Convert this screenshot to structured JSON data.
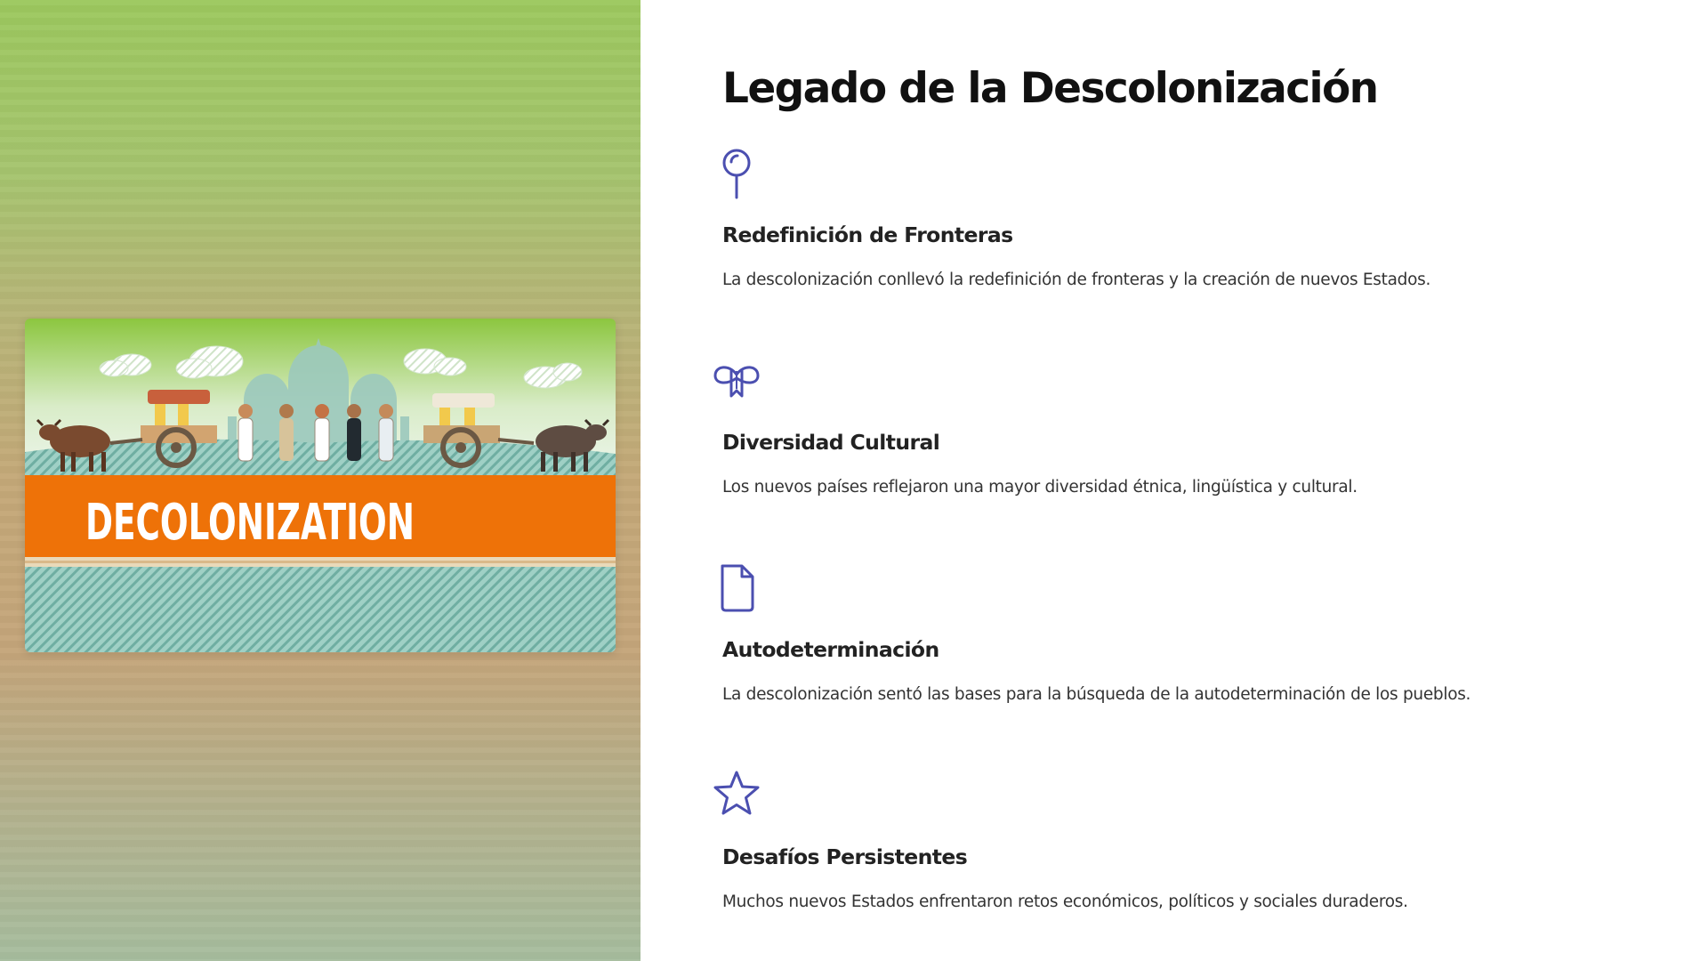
{
  "hero_image": {
    "banner_text": "DECOLONIZATION",
    "colors": {
      "banner": "#ee7208",
      "teal": "#8dc3b8",
      "sky_top": "#8cc63f"
    }
  },
  "page": {
    "title": "Legado de la Descolonización",
    "accent_color": "#4b4fb0"
  },
  "items": [
    {
      "icon": "map-pin-icon",
      "title": "Redefinición de Fronteras",
      "description": "La descolonización conllevó la redefinición de fronteras y la creación de nuevos Estados."
    },
    {
      "icon": "gift-ribbon-icon",
      "title": "Diversidad Cultural",
      "description": "Los nuevos países reflejaron una mayor diversidad étnica, lingüística y cultural."
    },
    {
      "icon": "document-icon",
      "title": "Autodeterminación",
      "description": "La descolonización sentó las bases para la búsqueda de la autodeterminación de los pueblos."
    },
    {
      "icon": "star-icon",
      "title": "Desafíos Persistentes",
      "description": "Muchos nuevos Estados enfrentaron retos económicos, políticos y sociales duraderos."
    }
  ]
}
